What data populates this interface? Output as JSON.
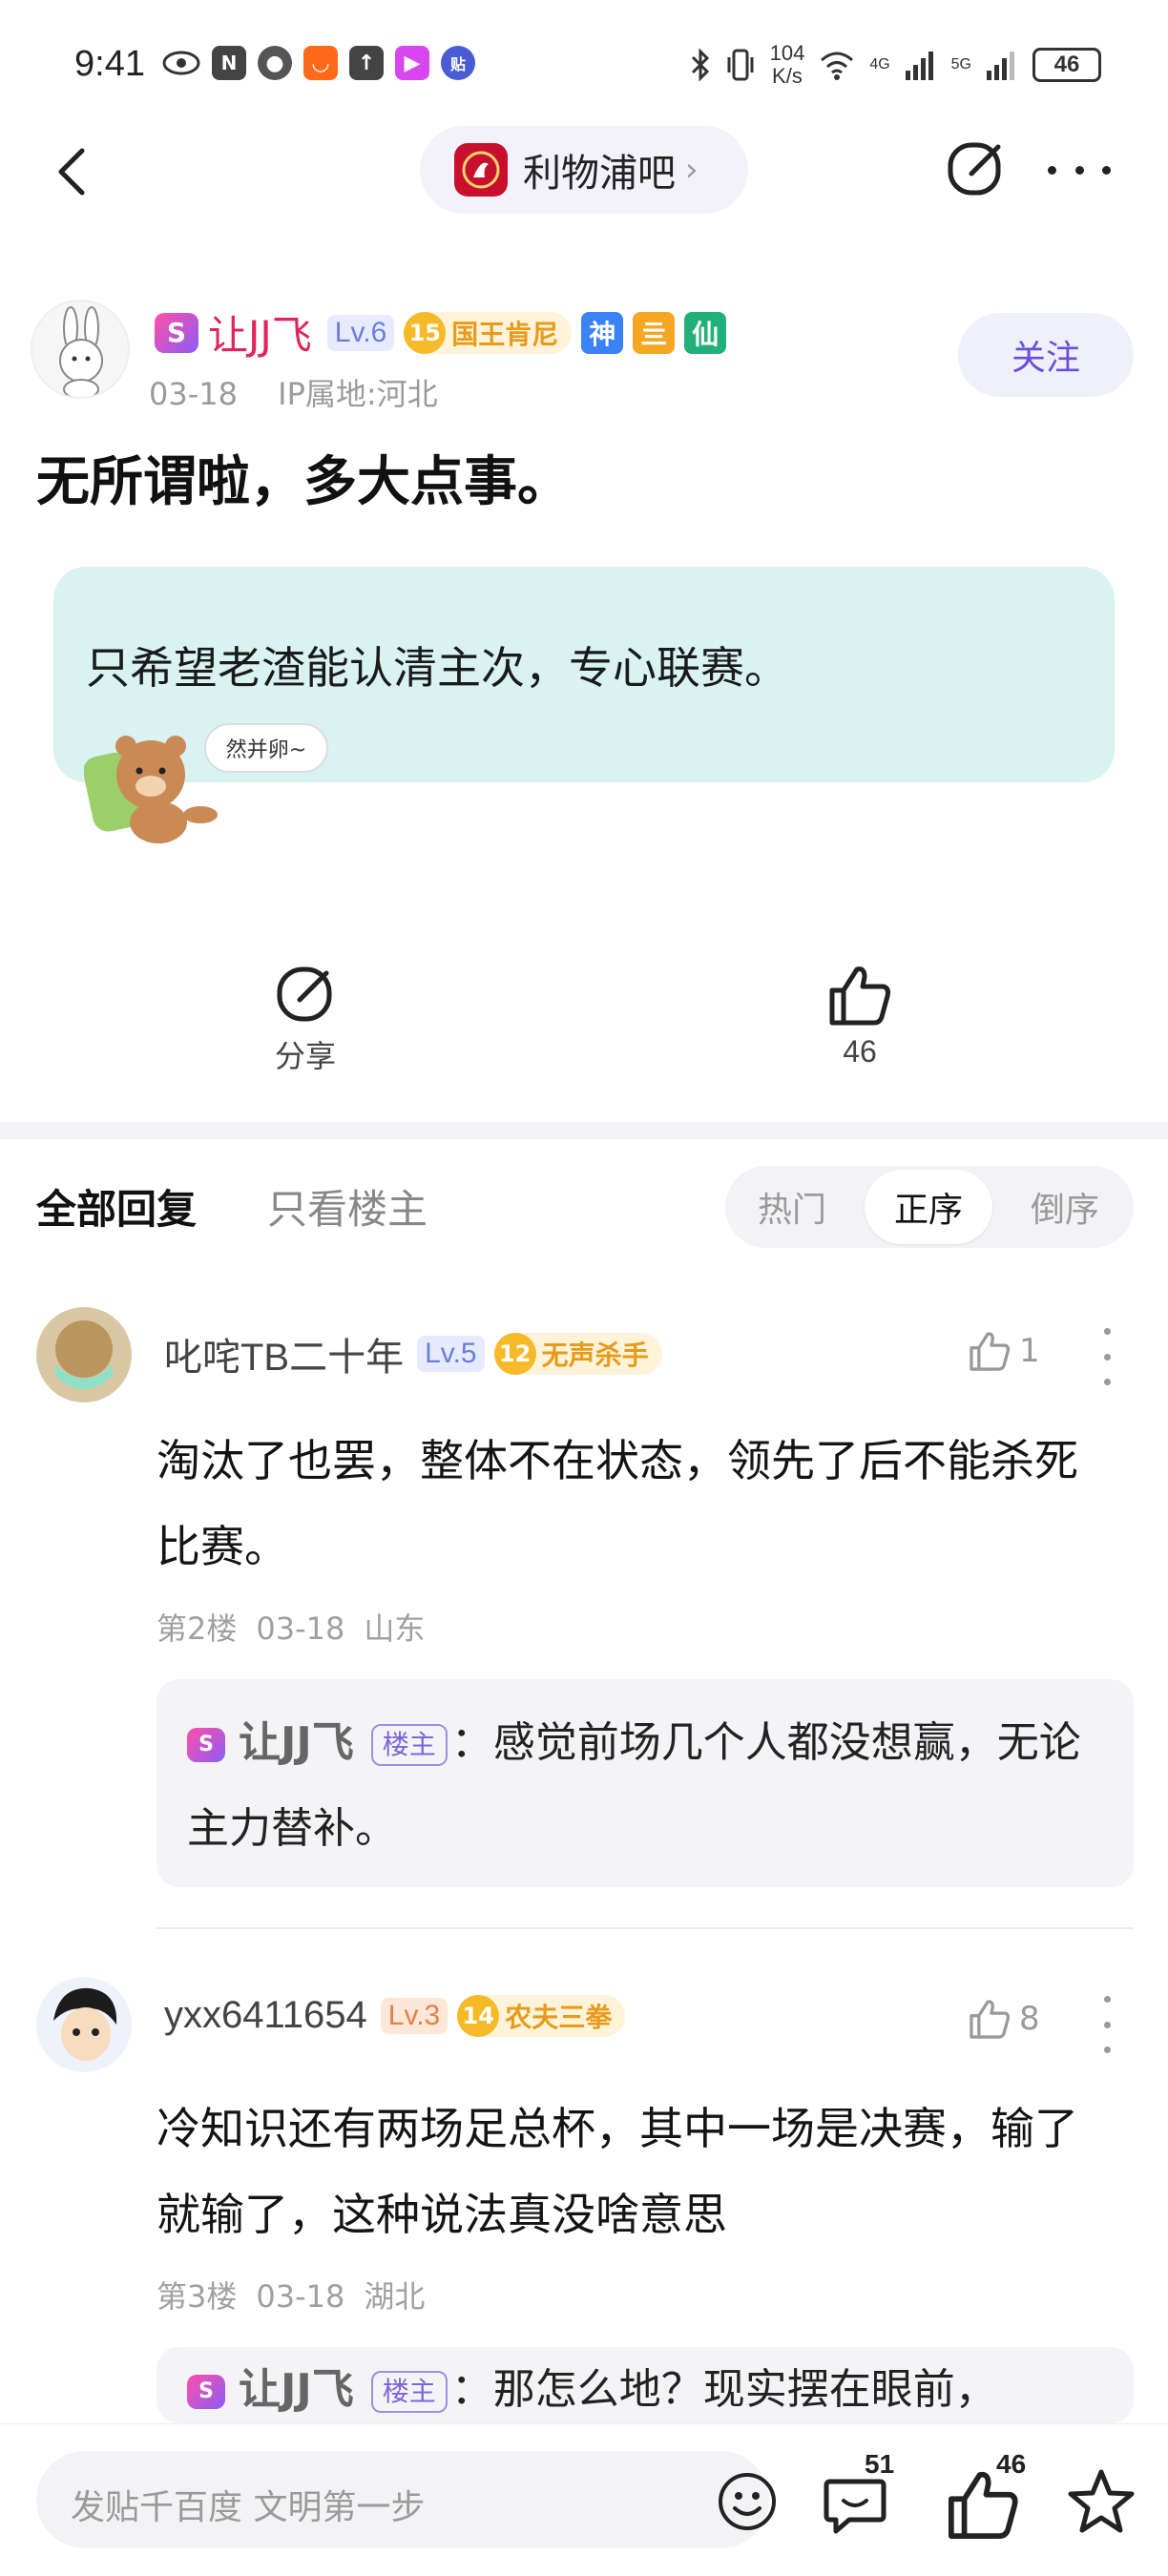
{
  "status_bar": {
    "time": "9:41",
    "speed_value": "104",
    "speed_unit": "K/s",
    "network_a": "4G",
    "network_b": "5G",
    "battery": "46"
  },
  "nav": {
    "forum_name": "利物浦吧"
  },
  "post": {
    "author": "让JJ飞",
    "level": "Lv.6",
    "honor_level": "15",
    "honor_title": "国王肯尼",
    "badges": [
      "神",
      "亖",
      "仙"
    ],
    "date": "03-18",
    "ip": "IP属地:河北",
    "follow_label": "关注",
    "title": "无所谓啦，多大点事。",
    "bubble_text": "只希望老渣能认清主次，专心联赛。",
    "sticker_text": "然并卵~",
    "share_label": "分享",
    "like_count": "46"
  },
  "tabs": {
    "all_replies": "全部回复",
    "op_only": "只看楼主",
    "sort_options": [
      "热门",
      "正序",
      "倒序"
    ],
    "active_sort": "正序"
  },
  "comments": [
    {
      "name": "叱咤TB二十年",
      "level": "Lv.5",
      "honor_level": "12",
      "honor_title": "无声杀手",
      "likes": "1",
      "text": "淘汰了也罢，整体不在状态，领先了后不能杀死比赛。",
      "floor": "第2楼",
      "date": "03-18",
      "location": "山东",
      "reply": {
        "name": "让JJ飞",
        "tag": "楼主",
        "text": "：感觉前场几个人都没想赢，无论主力替补。"
      }
    },
    {
      "name": "yxx6411654",
      "level": "Lv.3",
      "honor_level": "14",
      "honor_title": "农夫三拳",
      "likes": "8",
      "text": "冷知识还有两场足总杯，其中一场是决赛，输了就输了，这种说法真没啥意思",
      "floor": "第3楼",
      "date": "03-18",
      "location": "湖北",
      "reply": {
        "name": "让JJ飞",
        "tag": "楼主",
        "text": "：那怎么地？现实摆在眼前，"
      }
    }
  ],
  "bottom_bar": {
    "input_placeholder": "发贴千百度 文明第一步",
    "comment_count": "51",
    "like_count": "46"
  },
  "colors": {
    "accent_purple": "#6b4fd8",
    "op_name_red": "#e0245e",
    "bubble_bg": "#d8f3f1",
    "honor_gold": "#f6b928"
  }
}
